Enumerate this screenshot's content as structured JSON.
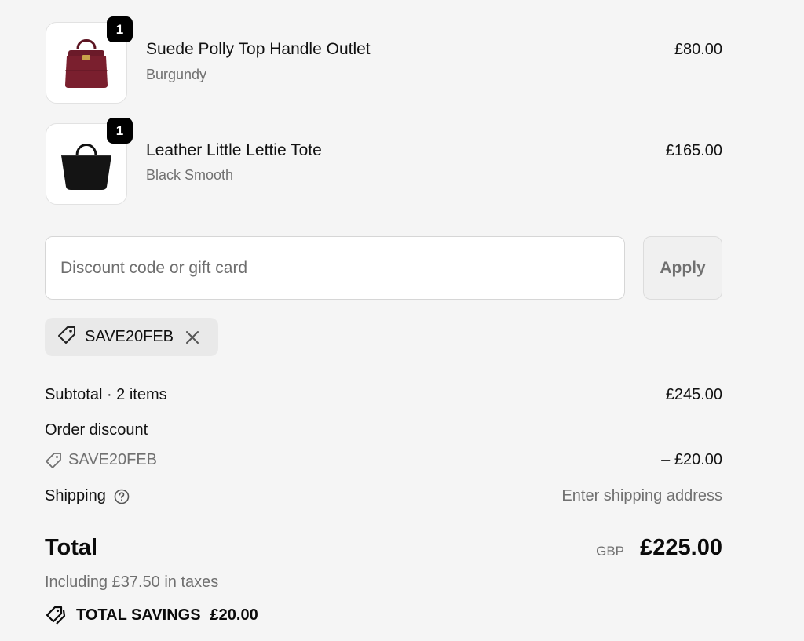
{
  "items": [
    {
      "name": "Suede Polly Top Handle Outlet",
      "variant": "Burgundy",
      "price": "£80.00",
      "quantity": "1",
      "color": "#7a1f2e"
    },
    {
      "name": "Leather Little Lettie Tote",
      "variant": "Black Smooth",
      "price": "£165.00",
      "quantity": "1",
      "color": "#141414"
    }
  ],
  "discount": {
    "placeholder": "Discount code or gift card",
    "apply_label": "Apply",
    "applied_code": "SAVE20FEB"
  },
  "summary": {
    "subtotal_label": "Subtotal · 2 items",
    "subtotal_value": "£245.00",
    "order_discount_label": "Order discount",
    "discount_code": "SAVE20FEB",
    "discount_value": "– £20.00",
    "shipping_label": "Shipping",
    "shipping_value": "Enter shipping address",
    "total_label": "Total",
    "currency": "GBP",
    "total_value": "£225.00",
    "tax_note": "Including £37.50 in taxes",
    "savings_label": "TOTAL SAVINGS",
    "savings_value": "£20.00"
  },
  "icons": {
    "tag": "tag-icon",
    "close": "close-icon",
    "help": "question-circle-icon",
    "savings": "savings-tag-icon"
  }
}
